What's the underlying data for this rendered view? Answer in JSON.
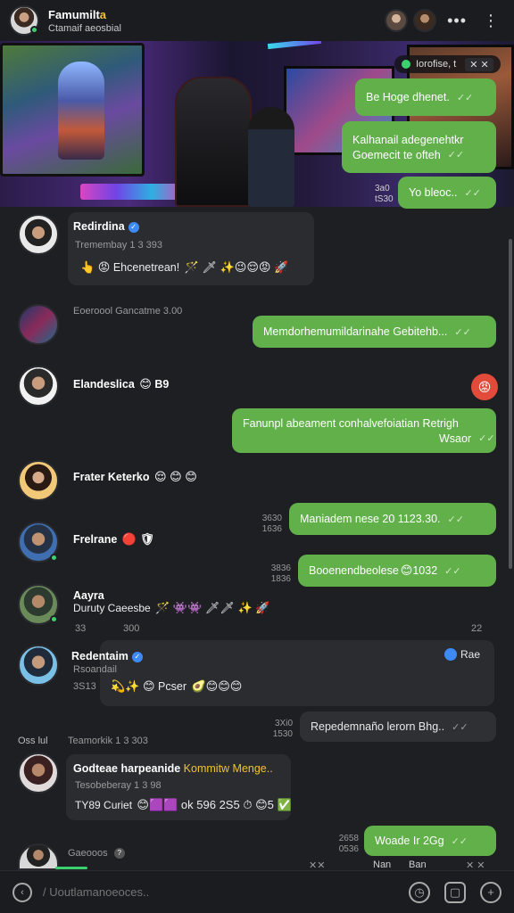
{
  "header": {
    "title": "Famumilt",
    "title_accent": "a",
    "subtitle": "Ctamaif aeosbial",
    "menu_glyph": "•••",
    "kebab_glyph": "⋮"
  },
  "hero": {
    "chip_text": "Iorofise, t",
    "chip_x": "✕ ✕",
    "timestamp_1": "3a0",
    "timestamp_2": "tS30"
  },
  "messages": {
    "m1": {
      "text": "Be Hoge dhenet.",
      "tick": "✓✓"
    },
    "m2": {
      "line1": "Kalhanail adegenehtkr",
      "line2": "Goemecit te ofteh",
      "tick": "✓✓"
    },
    "m3": {
      "text": "Yo bleoc..",
      "tick": "✓✓"
    },
    "c1": {
      "name": "Redirdina",
      "meta": "Tremembay 1 3 393",
      "text": "Ehcenetrean!",
      "emojis_before": "👆 😡",
      "emojis_after": "🪄 🗡 ✨😉😌😡 🚀"
    },
    "c2": {
      "meta": "Eoeroool Gancatme 3.00"
    },
    "m4": {
      "text": "Memdorhemumildarinahe Gebitehb...",
      "tick": "✓✓"
    },
    "c3": {
      "name": "Elandeslica",
      "emoji": "😊",
      "suffix": "B9"
    },
    "react1": "😡",
    "m5": {
      "line1": "Fanunpl abeament conhalvefoiatian Retrigh",
      "line2": "Wsaor",
      "tick": "✓✓"
    },
    "c4": {
      "name": "Frater Keterko",
      "emojis": "😌 😊 😊"
    },
    "m6": {
      "text": "Maniadem nese 20 1123.30.",
      "tick": "✓✓",
      "side_1": "3630",
      "side_2": "1636"
    },
    "c5": {
      "name": "Frelrane",
      "emojis": "🔴 🛡"
    },
    "m7": {
      "text": "Booenendbeolese",
      "emoji": "😊",
      "suffix": "1032",
      "tick": "✓✓",
      "side_1": "3836",
      "side_2": "1836"
    },
    "c6": {
      "name": "Aayra",
      "meta": "Duruty Caeesbe",
      "emojis": "🪄 👾👾 🗡🗡 ✨ 🚀",
      "side_1": "33",
      "side_2": "300",
      "side_3": "22"
    },
    "c7": {
      "name": "Redentaim",
      "meta_1": "Rsoandail",
      "meta_2": "3S13",
      "text": "Pcser",
      "emojis_before": "💫✨ 😊",
      "emojis_after": "🥑😊😊😊",
      "react": "Rae"
    },
    "m8": {
      "text": "Repedemnaño lerorn Bhg..",
      "tick": "✓✓",
      "side_1": "3Xi0",
      "side_2": "1530"
    },
    "c8": {
      "meta": "Oss lul",
      "meta2": "Teamorkik 1 3 303"
    },
    "c9": {
      "title": "Godteae harpeanide",
      "title_accent": "Kommitw Menge..",
      "meta": "Tesobeberay 1 3 98",
      "prefix": "TY89",
      "text": "Curiet",
      "emojis": "😊🟪🟪 ok 596 2S5 ⏱ 😊5 ✅"
    },
    "m9": {
      "text": "Woade Ir 2Gg",
      "tick": "✓✓",
      "side_1": "2658",
      "side_2": "0536"
    },
    "c10": {
      "name": "Gaeooos",
      "badge": "?",
      "side_1": "✕✕",
      "side_2": "Nan",
      "side_3": "Ban",
      "side_4": "✕ ✕"
    }
  },
  "composer": {
    "placeholder": "/ Uoutlamanoeoces..",
    "icons": [
      "clock-icon",
      "camera-icon",
      "square-icon",
      "plus-icon"
    ]
  }
}
